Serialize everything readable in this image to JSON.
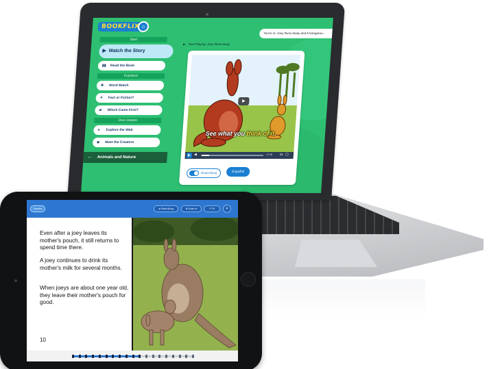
{
  "laptop": {
    "app": {
      "logo": "BOOKFLIX",
      "home_icon": "home-icon",
      "now_watching_tag": "You're in: Joey Runs Away and A Kangaroo...",
      "menu": {
        "start_label": "Start",
        "watch_story": "Watch the Story",
        "read_book": "Read the Book",
        "puzzlers_label": "Puzzlers!",
        "word_match": "Word Match",
        "fact_or_fiction": "Fact or Fiction?",
        "which_came_first": "Which Came First?",
        "dive_deeper_label": "Dive Deeper",
        "explore_web": "Explore the Web",
        "meet_creators": "Meet the Creators",
        "animals_nature": "Animals and Nature"
      },
      "now_playing": "Now Playing: Joey Runs Away",
      "video": {
        "caption_before": "See what you ",
        "caption_highlight": "think of it",
        "caption_after": ".",
        "time": "-1:16",
        "speed": "2x",
        "progress": 0.12
      },
      "read_along": "Read Along",
      "espanol": "Español"
    }
  },
  "tablet": {
    "toolbar": {
      "espanol": "Español",
      "read_along": "Read Along",
      "zoom_in": "Zoom In",
      "fit": "Fit"
    },
    "page": {
      "para1": "Even after a joey leaves its mother's pouch, it still returns to spend time there.",
      "para2": "A joey continues to drink its mother's milk for several months.",
      "para3": "When joeys are about one year old, they leave their mother's pouch for good.",
      "page_number": "10"
    },
    "progress": {
      "current_page": 11,
      "total_pages": 19
    }
  }
}
